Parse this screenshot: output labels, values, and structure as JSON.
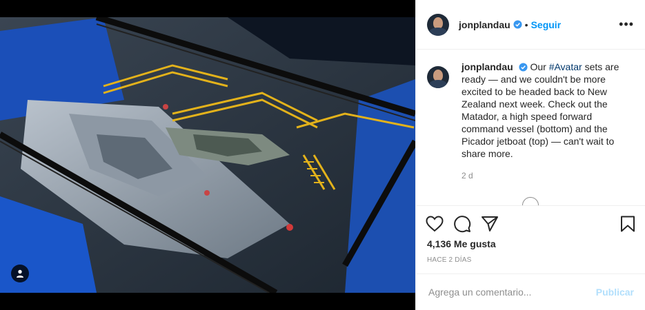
{
  "post": {
    "username": "jonplandau",
    "follow_label": "Seguir",
    "more_icon": "ellipsis-icon",
    "caption_parts": {
      "before": "Our ",
      "hashtag": "#Avatar",
      "after": " sets are ready — and we couldn't be more excited to be headed back to New Zealand next week. Check out the Matador, a high speed forward command vessel (bottom) and the Picador jetboat (top) — can't wait to share more."
    },
    "caption_time": "2 d",
    "likes": "4,136 Me gusta",
    "posted_ago": "HACE 2 DÍAS",
    "comment_placeholder": "Agrega un comentario...",
    "publish_label": "Publicar"
  },
  "colors": {
    "accent": "#0095f6",
    "publish_disabled": "#b2dffc",
    "verified": "#3897f0"
  }
}
